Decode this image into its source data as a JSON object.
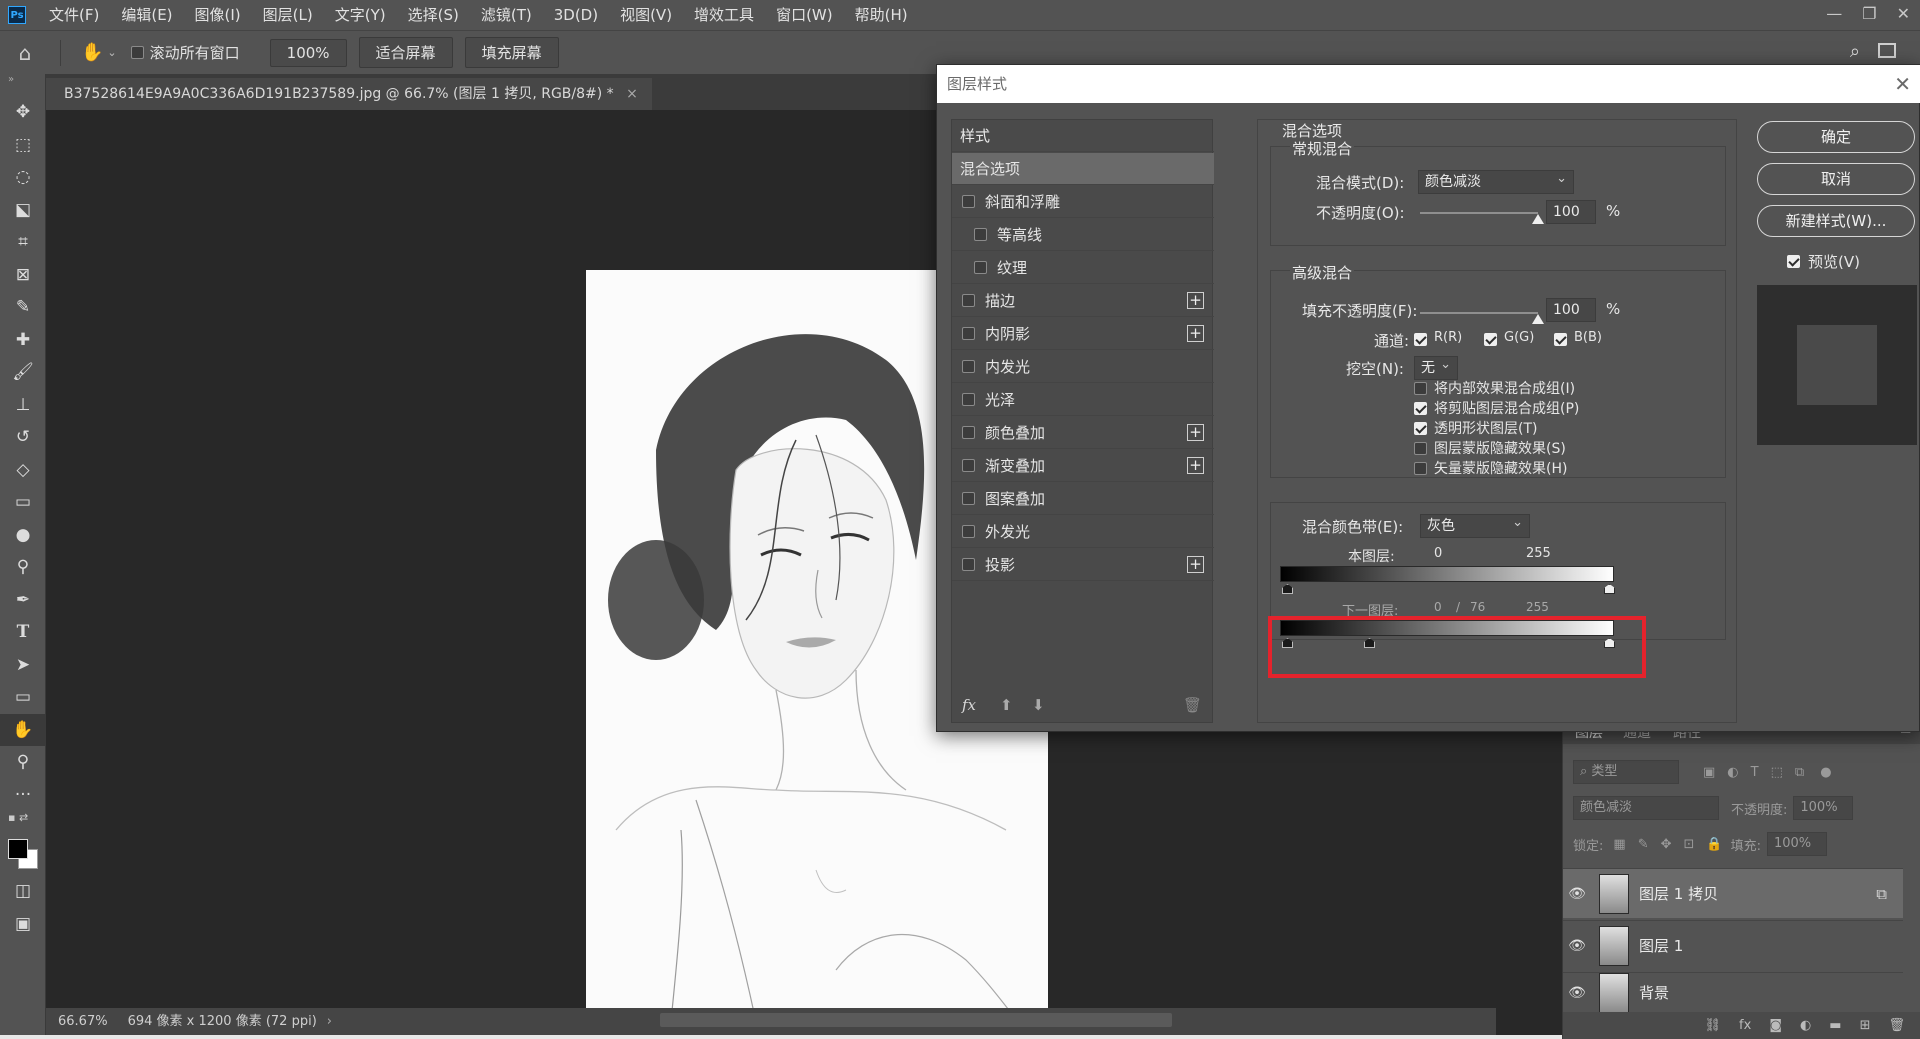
{
  "menubar": {
    "app_icon": "Ps",
    "items": [
      "文件(F)",
      "编辑(E)",
      "图像(I)",
      "图层(L)",
      "文字(Y)",
      "选择(S)",
      "滤镜(T)",
      "3D(D)",
      "视图(V)",
      "增效工具",
      "窗口(W)",
      "帮助(H)"
    ],
    "window_controls": [
      "minimize-icon",
      "restore-icon",
      "close-icon"
    ]
  },
  "optbar": {
    "scroll_all_label": "滚动所有窗口",
    "zoom_value": "100%",
    "fit_screen": "适合屏幕",
    "fill_screen": "填充屏幕"
  },
  "toolbar": {
    "tools": [
      "move-icon",
      "marquee-icon",
      "lasso-icon",
      "object-select-icon",
      "crop-icon",
      "frame-icon",
      "eyedropper-icon",
      "healing-icon",
      "brush-icon",
      "stamp-icon",
      "history-brush-icon",
      "eraser-icon",
      "gradient-icon",
      "blur-icon",
      "dodge-icon",
      "pen-icon",
      "type-icon",
      "path-select-icon",
      "rectangle-icon",
      "hand-icon",
      "zoom-icon",
      "more-icon"
    ]
  },
  "document": {
    "tab_title": "B37528614E9A9A0C336A6D191B237589.jpg @ 66.7% (图层 1 拷贝, RGB/8#) *"
  },
  "status": {
    "zoom": "66.67%",
    "dimensions": "694 像素 x 1200 像素 (72 ppi)"
  },
  "layers_panel": {
    "tabs": [
      "图层",
      "通道",
      "路径"
    ],
    "filter_placeholder": "类型",
    "blend_mode": "颜色减淡",
    "opacity_label": "不透明度:",
    "opacity_value": "100%",
    "lock_label": "锁定:",
    "fill_label": "填充:",
    "fill_value": "100%",
    "layers": [
      {
        "name": "图层 1 拷贝",
        "selected": true
      },
      {
        "name": "图层 1",
        "selected": false
      },
      {
        "name": "背景",
        "selected": false
      }
    ]
  },
  "dialog": {
    "title": "图层样式",
    "style_list": {
      "header": "样式",
      "selected": "混合选项",
      "items": [
        {
          "label": "斜面和浮雕",
          "sub": false,
          "plus": false
        },
        {
          "label": "等高线",
          "sub": true,
          "plus": false
        },
        {
          "label": "纹理",
          "sub": true,
          "plus": false
        },
        {
          "label": "描边",
          "sub": false,
          "plus": true
        },
        {
          "label": "内阴影",
          "sub": false,
          "plus": true
        },
        {
          "label": "内发光",
          "sub": false,
          "plus": false
        },
        {
          "label": "光泽",
          "sub": false,
          "plus": false
        },
        {
          "label": "颜色叠加",
          "sub": false,
          "plus": true
        },
        {
          "label": "渐变叠加",
          "sub": false,
          "plus": true
        },
        {
          "label": "图案叠加",
          "sub": false,
          "plus": false
        },
        {
          "label": "外发光",
          "sub": false,
          "plus": false
        },
        {
          "label": "投影",
          "sub": false,
          "plus": true
        }
      ],
      "footer_fx": "fx"
    },
    "blend_options": {
      "section_title": "混合选项",
      "general_title": "常规混合",
      "blend_mode_label": "混合模式(D):",
      "blend_mode_value": "颜色减淡",
      "opacity_label": "不透明度(O):",
      "opacity_value": "100",
      "opacity_unit": "%",
      "advanced_title": "高级混合",
      "fill_opacity_label": "填充不透明度(F):",
      "fill_opacity_value": "100",
      "fill_opacity_unit": "%",
      "channels_label": "通道:",
      "channel_r": "R(R)",
      "channel_g": "G(G)",
      "channel_b": "B(B)",
      "knockout_label": "挖空(N):",
      "knockout_value": "无",
      "options": [
        {
          "label": "将内部效果混合成组(I)",
          "checked": false
        },
        {
          "label": "将剪贴图层混合成组(P)",
          "checked": true
        },
        {
          "label": "透明形状图层(T)",
          "checked": true
        },
        {
          "label": "图层蒙版隐藏效果(S)",
          "checked": false
        },
        {
          "label": "矢量蒙版隐藏效果(H)",
          "checked": false
        }
      ],
      "blend_if_label": "混合颜色带(E):",
      "blend_if_value": "灰色",
      "this_layer_label": "本图层:",
      "this_layer_min": "0",
      "this_layer_max": "255",
      "underlying_label": "下一图层:",
      "underlying_min": "0",
      "underlying_split": "/",
      "underlying_mid": "76",
      "underlying_max": "255"
    },
    "buttons": {
      "ok": "确定",
      "cancel": "取消",
      "new_style": "新建样式(W)...",
      "preview_label": "预览(V)"
    }
  },
  "colors": {
    "highlight": "#e5232c",
    "ui_bg": "#535353",
    "canvas_bg": "#282828"
  }
}
